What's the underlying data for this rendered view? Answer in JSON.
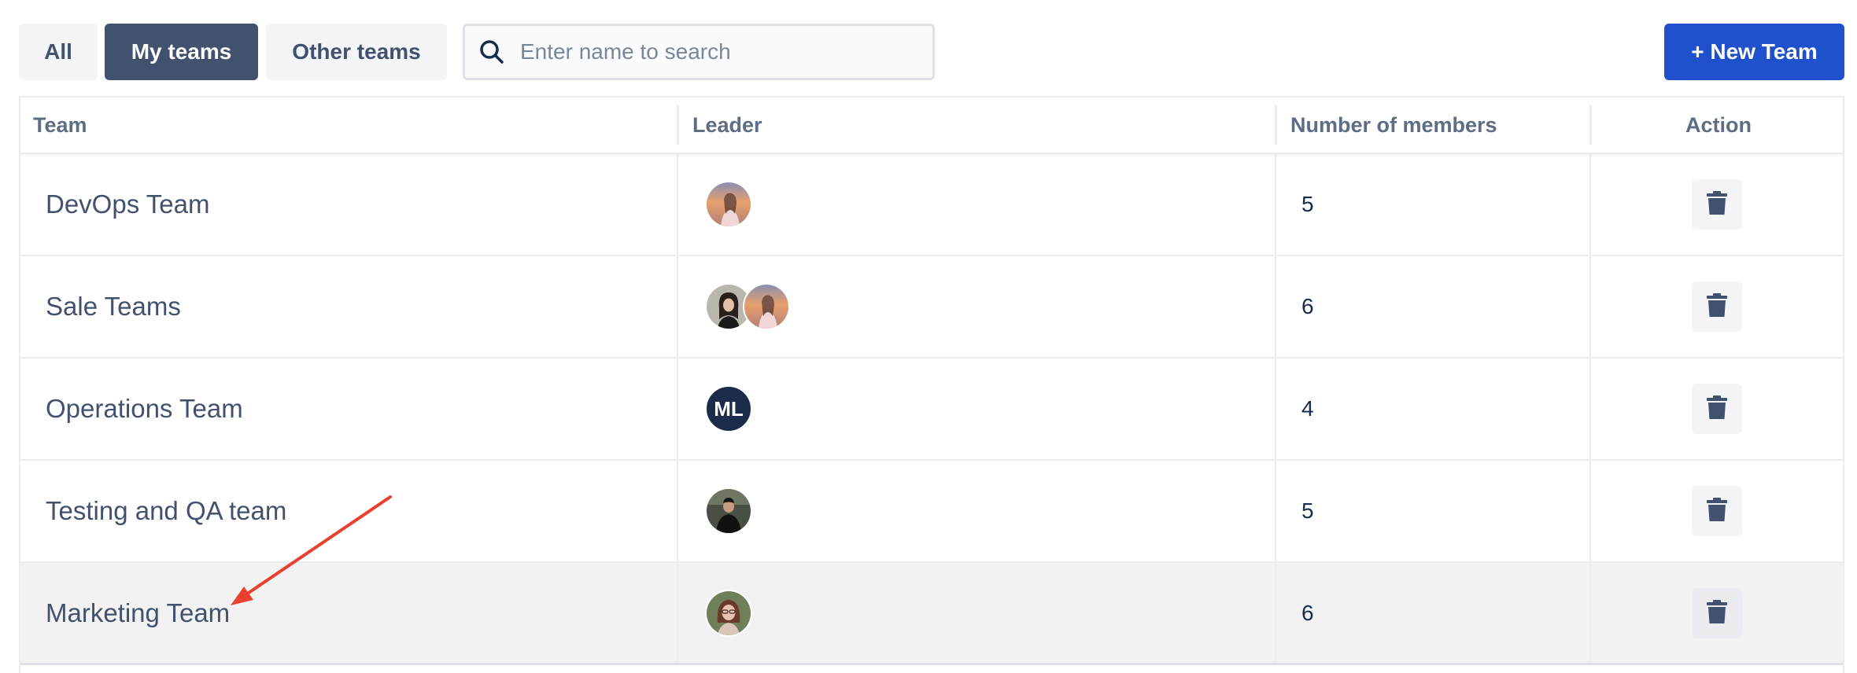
{
  "filters": {
    "all_label": "All",
    "my_teams_label": "My teams",
    "other_teams_label": "Other teams",
    "active": "My teams"
  },
  "search": {
    "placeholder": "Enter name to search",
    "value": ""
  },
  "new_team_label": "+ New Team",
  "table": {
    "headers": {
      "team": "Team",
      "leader": "Leader",
      "members": "Number of members",
      "action": "Action"
    },
    "rows": [
      {
        "team": "DevOps Team",
        "leader_avatars": [
          "photo-woman-sunset"
        ],
        "members": "5"
      },
      {
        "team": "Sale Teams",
        "leader_avatars": [
          "photo-woman-dark-hair",
          "photo-woman-sunset"
        ],
        "members": "6"
      },
      {
        "team": "Operations Team",
        "leader_avatars": [
          "initials-ML"
        ],
        "leader_initials": "ML",
        "members": "4"
      },
      {
        "team": "Testing and QA team",
        "leader_avatars": [
          "photo-man-dark"
        ],
        "members": "5"
      },
      {
        "team": "Marketing Team",
        "leader_avatars": [
          "photo-woman-glasses"
        ],
        "members": "6"
      }
    ]
  },
  "colors": {
    "primary": "#1f51cc",
    "active_filter": "#42526e",
    "text": "#42526e",
    "row_highlight": "#f2f2f2",
    "annotation_arrow": "#e8412f",
    "initials_avatar": "#1c2b4a"
  }
}
